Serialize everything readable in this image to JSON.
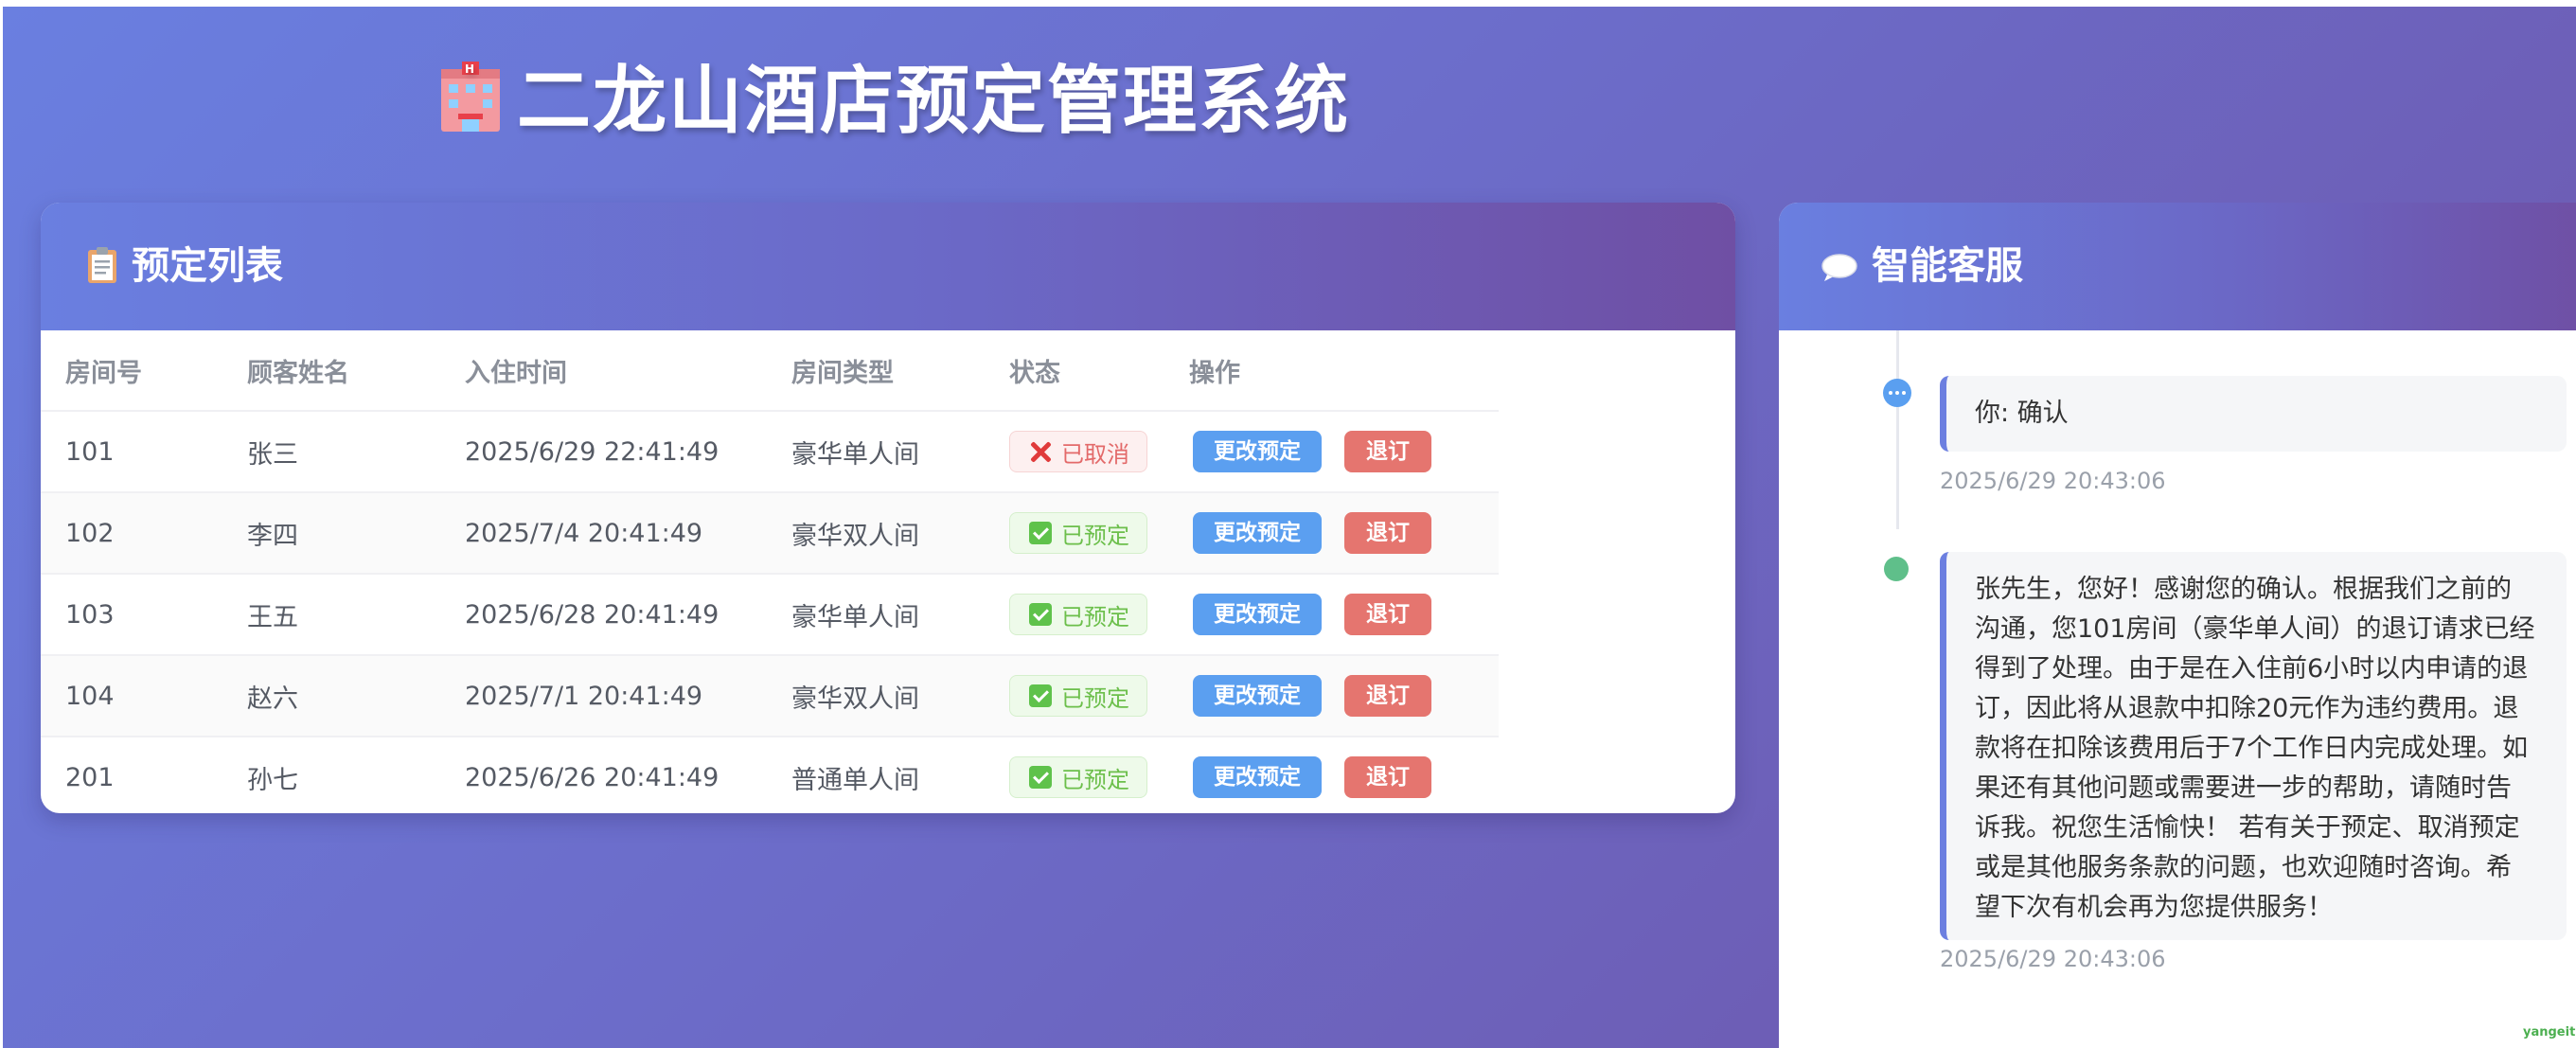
{
  "app": {
    "title": "二龙山酒店预定管理系统",
    "title_icon": "hotel-icon"
  },
  "bookings": {
    "title": "预定列表",
    "title_icon": "clipboard-icon",
    "columns": [
      "房间号",
      "顾客姓名",
      "入住时间",
      "房间类型",
      "状态",
      "操作"
    ],
    "rows": [
      {
        "room": "101",
        "name": "张三",
        "checkin": "2025/6/29 22:41:49",
        "type": "豪华单人间",
        "status": "已取消",
        "status_kind": "cancelled",
        "modify": "更改预定",
        "cancel": "退订"
      },
      {
        "room": "102",
        "name": "李四",
        "checkin": "2025/7/4 20:41:49",
        "type": "豪华双人间",
        "status": "已预定",
        "status_kind": "booked",
        "modify": "更改预定",
        "cancel": "退订"
      },
      {
        "room": "103",
        "name": "王五",
        "checkin": "2025/6/28 20:41:49",
        "type": "豪华单人间",
        "status": "已预定",
        "status_kind": "booked",
        "modify": "更改预定",
        "cancel": "退订"
      },
      {
        "room": "104",
        "name": "赵六",
        "checkin": "2025/7/1 20:41:49",
        "type": "豪华双人间",
        "status": "已预定",
        "status_kind": "booked",
        "modify": "更改预定",
        "cancel": "退订"
      },
      {
        "room": "201",
        "name": "孙七",
        "checkin": "2025/6/26 20:41:49",
        "type": "普通单人间",
        "status": "已预定",
        "status_kind": "booked",
        "modify": "更改预定",
        "cancel": "退订"
      }
    ],
    "colors": {
      "modify_button": "#5b9ff0",
      "cancel_button": "#e5756f",
      "cancelled_text": "#e36a6a",
      "booked_text": "#6cbf4b"
    }
  },
  "chat": {
    "title": "智能客服",
    "title_icon": "speech-bubble-icon",
    "messages": [
      {
        "role": "user",
        "text": "你: 确认",
        "time": "2025/6/29 20:43:06"
      },
      {
        "role": "bot",
        "lines": [
          "张先生，您好！感谢您的确认。根据我们之前的",
          "沟通，您101房间（豪华单人间）的退订请求已经",
          "得到了处理。由于是在入住前6小时以内申请的退",
          "订，因此将从退款中扣除20元作为违约费用。退",
          "款将在扣除该费用后于7个工作日内完成处理。如",
          "果还有其他问题或需要进一步的帮助，请随时告",
          "诉我。祝您生活愉快！ 若有关于预定、取消预定",
          "或是其他服务条款的问题，也欢迎随时咨询。希",
          "望下次有机会再为您提供服务！"
        ],
        "time": "2025/6/29 20:43:06"
      }
    ]
  },
  "watermark": "yangeit",
  "theme": {
    "gradient_start": "#6a7fe0",
    "gradient_end": "#6e54a8"
  }
}
